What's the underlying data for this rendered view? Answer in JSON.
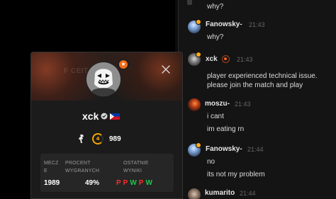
{
  "chat": {
    "messages": [
      {
        "username": "",
        "time": "",
        "lines": [
          "why?"
        ]
      },
      {
        "username": "Fanowsky-",
        "time": "21:43",
        "lines": [
          "why?"
        ]
      },
      {
        "username": "xck",
        "time": "21:43",
        "lines": [
          "player experienced technical issue.",
          "please join the match and play"
        ]
      },
      {
        "username": "moszu-",
        "time": "21:43",
        "lines": [
          "i cant",
          "im eating rn"
        ]
      },
      {
        "username": "Fanowsky-",
        "time": "21:44",
        "lines": [
          "no",
          "its not my problem"
        ]
      },
      {
        "username": "kumarito",
        "time": "21:44",
        "lines": []
      }
    ]
  },
  "profile": {
    "name": "xck",
    "elo": "989",
    "level": "4",
    "banner_text": "F   CEIT",
    "stats": {
      "matches_label_line1": "MECZ",
      "matches_label_line2": "E",
      "matches_value": "1989",
      "win_label_line1": "PROCENT",
      "win_label_line2": "WYGRANYCH",
      "win_value": "49%",
      "results_label_line1": "OSTATNIE",
      "results_label_line2": "WYNIKI",
      "results": [
        "P",
        "P",
        "W",
        "P",
        "W"
      ]
    }
  },
  "icons": {
    "close": "close-icon",
    "verified": "verified-icon",
    "flag": "philippines-flag-icon",
    "weapon": "pistol-icon",
    "level": "level-icon"
  },
  "colors": {
    "background": "#000000",
    "chat_panel": "#141414",
    "card": "#1b1b1c",
    "stats_box": "#262626",
    "text": "#ffffff",
    "muted": "#9a9a9a",
    "accent": "#f2a600",
    "win": "#1cc84a",
    "loss": "#ff2d2d"
  }
}
